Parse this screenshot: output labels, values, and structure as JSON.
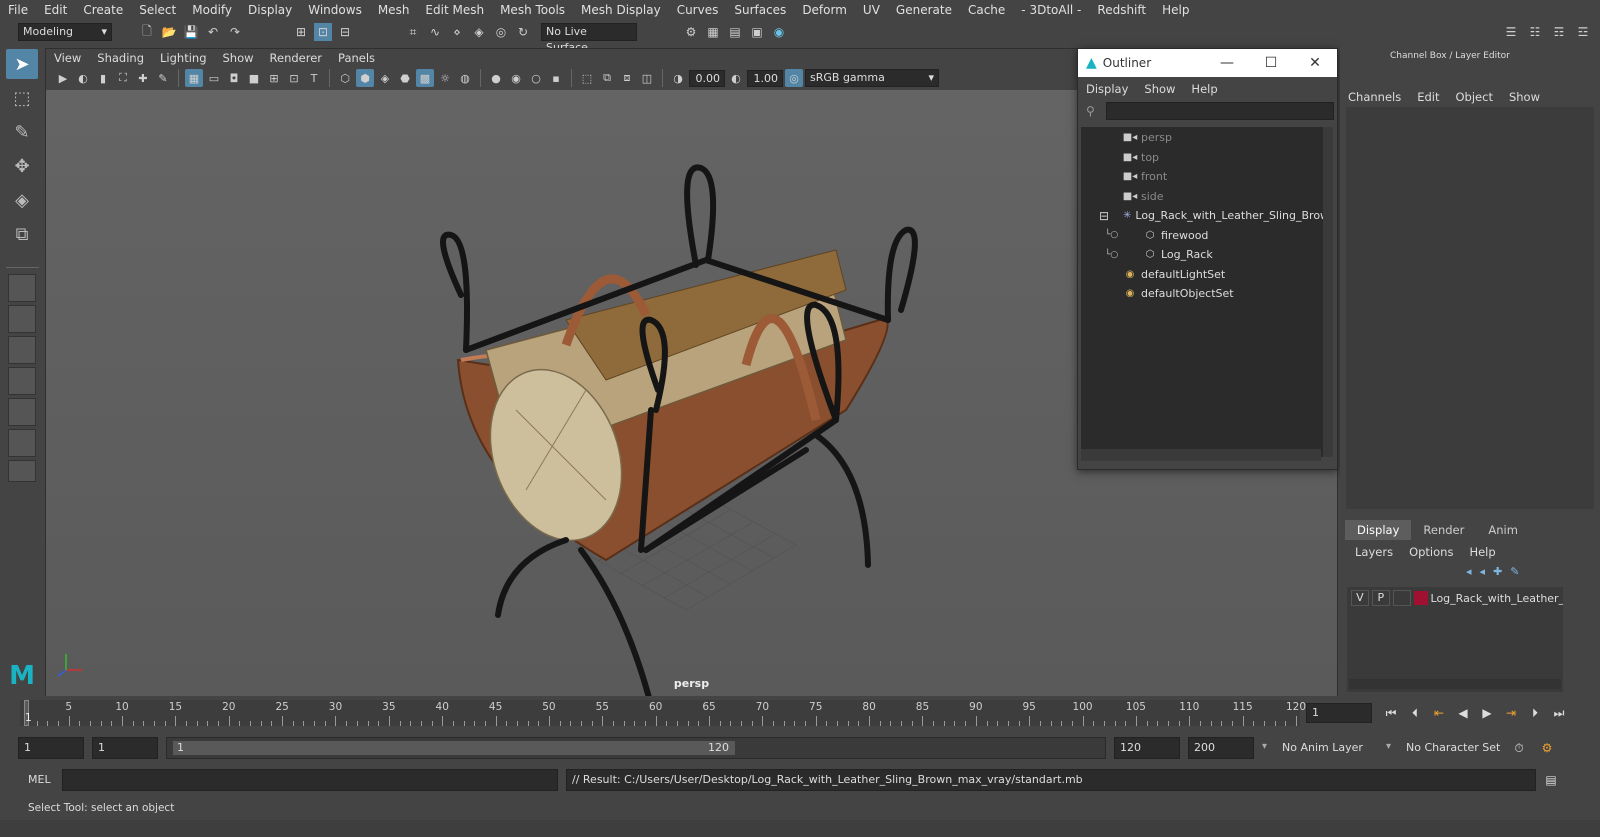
{
  "menubar": {
    "items": [
      "File",
      "Edit",
      "Create",
      "Select",
      "Modify",
      "Display",
      "Windows",
      "Mesh",
      "Edit Mesh",
      "Mesh Tools",
      "Mesh Display",
      "Curves",
      "Surfaces",
      "Deform",
      "UV",
      "Generate",
      "Cache",
      "- 3DtoAll -",
      "Redshift",
      "Help"
    ]
  },
  "status": {
    "mode": "Modeling",
    "live_surface": "No Live Surface"
  },
  "viewport": {
    "menu": [
      "View",
      "Shading",
      "Lighting",
      "Show",
      "Renderer",
      "Panels"
    ],
    "exposure": "0.00",
    "gamma": "1.00",
    "color_space": "sRGB gamma",
    "camera": "persp"
  },
  "outliner": {
    "title": "Outliner",
    "menu": [
      "Display",
      "Show",
      "Help"
    ],
    "items": [
      {
        "label": "persp",
        "icon": "camera-icon",
        "dim": true
      },
      {
        "label": "top",
        "icon": "camera-icon",
        "dim": true
      },
      {
        "label": "front",
        "icon": "camera-icon",
        "dim": true
      },
      {
        "label": "side",
        "icon": "camera-icon",
        "dim": true
      },
      {
        "label": "Log_Rack_with_Leather_Sling_Brown",
        "icon": "group-icon",
        "dim": false
      },
      {
        "label": "firewood",
        "icon": "mesh-icon",
        "dim": false
      },
      {
        "label": "Log_Rack",
        "icon": "mesh-icon",
        "dim": false
      },
      {
        "label": "defaultLightSet",
        "icon": "set-icon",
        "dim": false
      },
      {
        "label": "defaultObjectSet",
        "icon": "set-icon",
        "dim": false
      }
    ]
  },
  "channelbox": {
    "title": "Channel Box / Layer Editor",
    "menu": [
      "Channels",
      "Edit",
      "Object",
      "Show"
    ]
  },
  "layers": {
    "tabs": [
      "Display",
      "Render",
      "Anim"
    ],
    "menu": [
      "Layers",
      "Options",
      "Help"
    ],
    "row": {
      "v": "V",
      "p": "P",
      "name": "Log_Rack_with_Leather_",
      "color": "#a01030"
    }
  },
  "timeline": {
    "ticks": [
      "5",
      "10",
      "15",
      "20",
      "25",
      "30",
      "35",
      "40",
      "45",
      "50",
      "55",
      "60",
      "65",
      "70",
      "75",
      "80",
      "85",
      "90",
      "95",
      "100",
      "105",
      "110",
      "115",
      "120"
    ],
    "start_marker": "1",
    "current_frame": "1"
  },
  "range": {
    "start": "1",
    "playback_start": "1",
    "slider_start": "1",
    "slider_end": "120",
    "playback_end": "120",
    "end": "200",
    "anim_layer": "No Anim Layer",
    "character_set": "No Character Set"
  },
  "cmdline": {
    "lang": "MEL",
    "result": "// Result: C:/Users/User/Desktop/Log_Rack_with_Leather_Sling_Brown_max_vray/standart.mb"
  },
  "helpline": {
    "text": "Select Tool: select an object"
  }
}
